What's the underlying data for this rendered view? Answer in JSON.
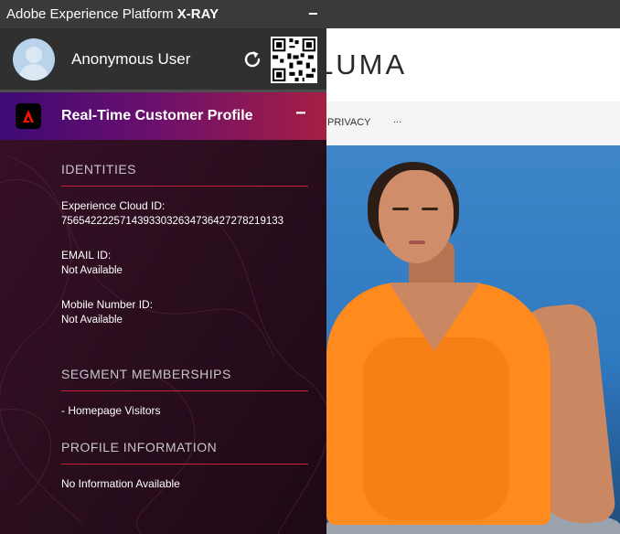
{
  "window": {
    "title_prefix": "Adobe Experience Platform",
    "title_bold": "X-RAY",
    "collapse_symbol": "−"
  },
  "user": {
    "name": "Anonymous User"
  },
  "profile_section": {
    "title": "Real-Time Customer Profile",
    "collapse_symbol": "−",
    "identities": {
      "heading": "IDENTITIES",
      "experience_cloud_id_label": "Experience Cloud ID:",
      "experience_cloud_id_value": "75654222257143933032634736427278219133",
      "email_id_label": "EMAIL ID:",
      "email_id_value": "Not Available",
      "mobile_id_label": "Mobile Number ID:",
      "mobile_id_value": "Not Available"
    },
    "segments": {
      "heading": "SEGMENT MEMBERSHIPS",
      "items": [
        "- Homepage Visitors"
      ]
    },
    "profile_info": {
      "heading": "PROFILE INFORMATION",
      "value": "No Information Available"
    }
  },
  "website": {
    "logo": "LUMA",
    "nav": [
      "PRIVACY",
      "..."
    ]
  },
  "icons": {
    "refresh": "refresh-icon",
    "qr": "qr-code-icon",
    "adobe": "adobe-logo-icon",
    "avatar": "user-avatar-icon"
  },
  "colors": {
    "accent_red": "#c7243a",
    "header_gradient_start": "#3d0a74",
    "header_gradient_end": "#a41f43",
    "panel_bg": "#2a0f1c",
    "user_bar": "#303030"
  }
}
